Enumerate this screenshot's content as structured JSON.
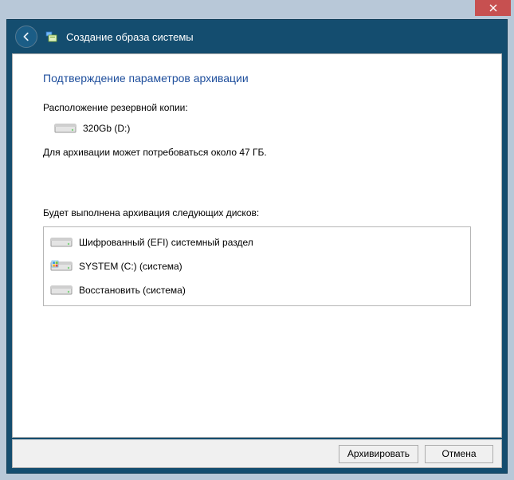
{
  "window": {
    "title": "Создание образа системы"
  },
  "page": {
    "heading": "Подтверждение параметров архивации",
    "backup_location_label": "Расположение резервной копии:",
    "destination_drive": "320Gb (D:)",
    "space_estimate": "Для архивации может потребоваться около 47 ГБ.",
    "disks_label": "Будет выполнена архивация следующих дисков:"
  },
  "disks": [
    {
      "label": "Шифрованный (EFI) системный раздел"
    },
    {
      "label": "SYSTEM (C:) (система)"
    },
    {
      "label": "Восстановить (система)"
    }
  ],
  "buttons": {
    "start": "Архивировать",
    "cancel": "Отмена"
  }
}
